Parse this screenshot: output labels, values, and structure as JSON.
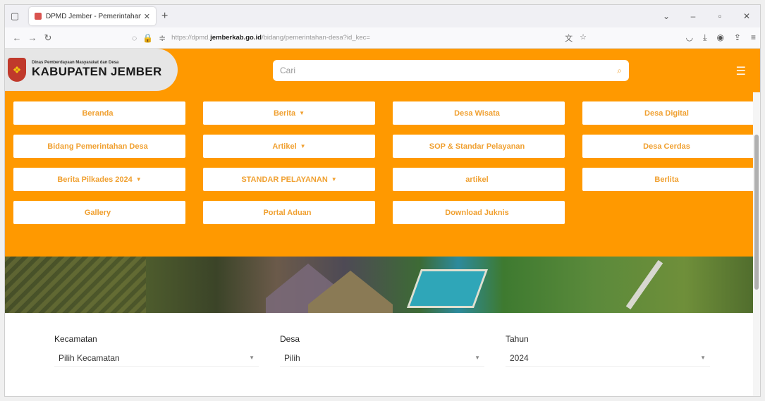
{
  "browser": {
    "tab_title": "DPMD Jember - Pemerintahan - K",
    "url_prefix": "https://dpmd.",
    "url_host": "jemberkab.go.id",
    "url_path": "/bidang/pemerintahan-desa?id_kec="
  },
  "site": {
    "logo_small": "Dinas Pemberdayaan Masyarakat dan Desa",
    "logo_big": "KABUPATEN JEMBER",
    "search_placeholder": "Cari"
  },
  "menu": [
    {
      "label": "Beranda",
      "caret": ""
    },
    {
      "label": "Berita",
      "caret": "▼"
    },
    {
      "label": "Desa Wisata",
      "caret": ""
    },
    {
      "label": "Desa Digital",
      "caret": ""
    },
    {
      "label": "Bidang Pemerintahan Desa",
      "caret": ""
    },
    {
      "label": "Artikel",
      "caret": "▼"
    },
    {
      "label": "SOP & Standar Pelayanan",
      "caret": ""
    },
    {
      "label": "Desa Cerdas",
      "caret": ""
    },
    {
      "label": "Berita Pilkades 2024",
      "caret": "▼"
    },
    {
      "label": "STANDAR PELAYANAN",
      "caret": "▼"
    },
    {
      "label": "artikel",
      "caret": ""
    },
    {
      "label": "Berlita",
      "caret": ""
    },
    {
      "label": "Gallery",
      "caret": ""
    },
    {
      "label": "Portal Aduan",
      "caret": ""
    },
    {
      "label": "Download Juknis",
      "caret": ""
    }
  ],
  "filters": {
    "kecamatan": {
      "label": "Kecamatan",
      "value": "Pilih Kecamatan"
    },
    "desa": {
      "label": "Desa",
      "value": "Pilih"
    },
    "tahun": {
      "label": "Tahun",
      "value": "2024"
    }
  },
  "colors": {
    "accent": "#ff9900",
    "menu_text": "#f0a030"
  }
}
